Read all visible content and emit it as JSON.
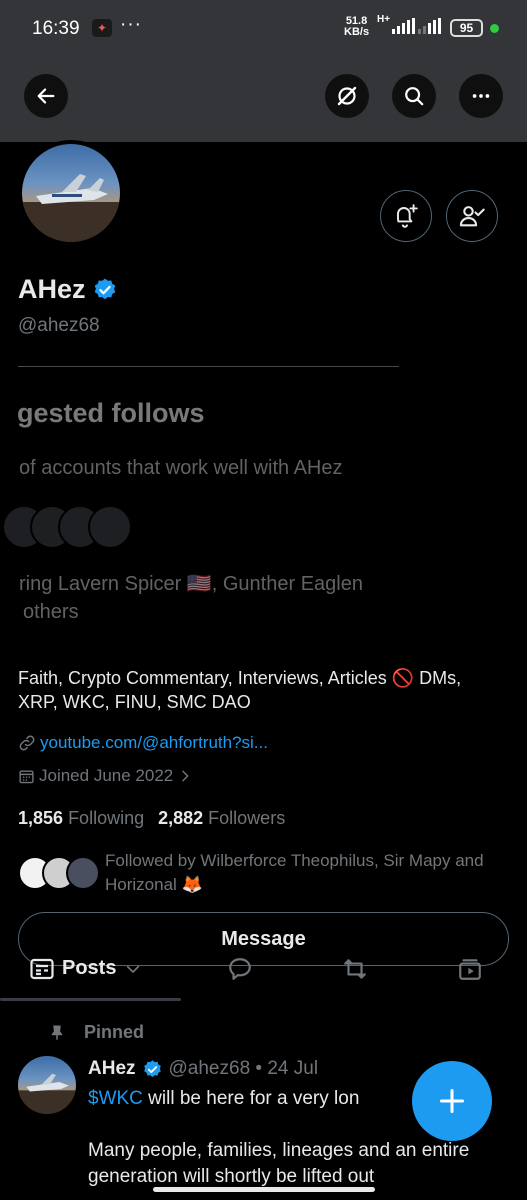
{
  "status_bar": {
    "time": "16:39",
    "dots": "···",
    "net_speed": "51.8",
    "net_unit": "KB/s",
    "net_type": "H+",
    "battery": "95"
  },
  "profile": {
    "name": "AHez",
    "handle": "@ahez68",
    "bio": "Faith, Crypto Commentary, Interviews, Articles 🚫 DMs, XRP, WKC, FINU, SMC DAO",
    "link": "youtube.com/@ahfortruth?si...",
    "joined": "Joined June 2022",
    "following_count": "1,856",
    "following_label": "Following",
    "followers_count": "2,882",
    "followers_label": "Followers",
    "followed_by": "Followed by Wilberforce Theophilus, Sir Mapy and Horizonal 🦊",
    "message_label": "Message"
  },
  "suggested": {
    "title": "gested follows",
    "subtitle": "of accounts that work well with AHez",
    "featuring_line1": "ring Lavern Spicer 🇺🇸, Gunther Eaglen",
    "featuring_line2": "others"
  },
  "tabs": {
    "posts_label": "Posts"
  },
  "pinned_tweet": {
    "pinned_label": "Pinned",
    "name": "AHez",
    "handle_date": "@ahez68 • 24 Jul",
    "cashtag": "$WKC",
    "text_line1_rest": " will be here for a very lon",
    "text_para2": "Many people, families, lineages and an entire generation will shortly be lifted out"
  },
  "colors": {
    "accent": "#1d9bf0",
    "header_bg": "#333538",
    "muted": "#71767b"
  },
  "icons": [
    "back-arrow-icon",
    "grok-icon",
    "search-icon",
    "more-icon",
    "notification-add-icon",
    "following-check-icon",
    "verified-badge-icon",
    "link-icon",
    "calendar-icon",
    "chevron-right-icon",
    "posts-tab-icon",
    "chevron-down-icon",
    "replies-tab-icon",
    "media-tab-icon",
    "video-tab-icon",
    "pin-icon",
    "compose-plus-icon"
  ]
}
